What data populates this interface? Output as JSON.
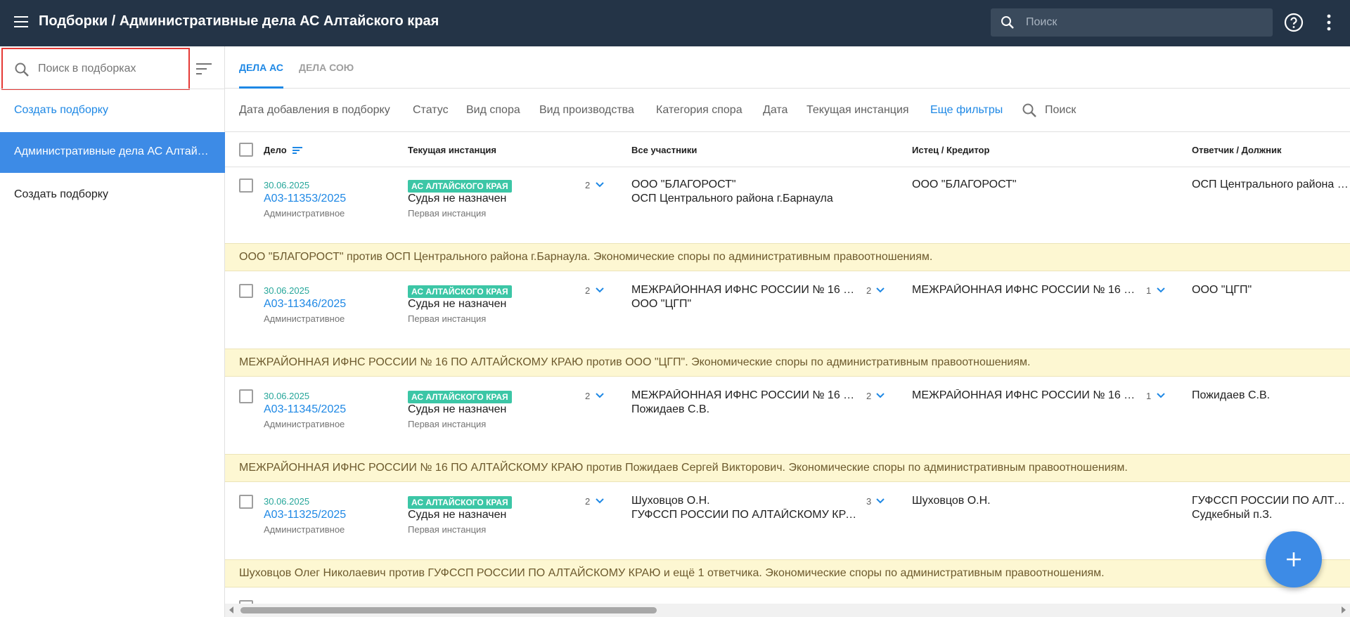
{
  "app": {
    "title": "Подборки / Административные дела АС Алтайского края",
    "search_placeholder": "Поиск"
  },
  "sidebar": {
    "search_placeholder": "Поиск в подборках",
    "create_link": "Создать подборку",
    "active_item": "Административные дела АС Алтайского края",
    "create_plain": "Создать подборку"
  },
  "tabs": [
    "ДЕЛА АС",
    "ДЕЛА СОЮ"
  ],
  "filters": [
    "Дата добавления в подборку",
    "Статус",
    "Вид спора",
    "Вид производства",
    "Категория спора",
    "Дата",
    "Текущая инстанция",
    "Еще фильтры"
  ],
  "filter_search": "Поиск",
  "columns": [
    "Дело",
    "Текущая инстанция",
    "Все участники",
    "Истец / Кредитор",
    "Ответчик / Должник"
  ],
  "rows": [
    {
      "date": "30.06.2025",
      "number": "А03-11353/2025",
      "type": "Административное",
      "badge": "АС АЛТАЙСКОГО КРАЯ",
      "judge": "Судья не назначен",
      "instance": "Первая инстанция",
      "instance_count": "2",
      "participants": [
        "ООО \"БЛАГОРОСТ\"",
        "ОСП Центрального района г.Барнаула"
      ],
      "participants_count": "",
      "plaintiff": "ООО \"БЛАГОРОСТ\"",
      "plaintiff_count": "",
      "defendant": [
        "ОСП Центрального района г.Барнаула"
      ],
      "summary": "ООО \"БЛАГОРОСТ\" против ОСП Центрального района г.Барнаула. Экономические споры по административным правоотношениям."
    },
    {
      "date": "30.06.2025",
      "number": "А03-11346/2025",
      "type": "Административное",
      "badge": "АС АЛТАЙСКОГО КРАЯ",
      "judge": "Судья не назначен",
      "instance": "Первая инстанция",
      "instance_count": "2",
      "participants": [
        "МЕЖРАЙОННАЯ ИФНС РОССИИ № 16 ПО АЛТАЙСКОМУ КРАЮ",
        "ООО \"ЦГП\""
      ],
      "participants_count": "2",
      "plaintiff": "МЕЖРАЙОННАЯ ИФНС РОССИИ № 16 ПО АЛТАЙСКОМУ КРАЮ",
      "plaintiff_count": "1",
      "defendant": [
        "ООО \"ЦГП\""
      ],
      "summary": "МЕЖРАЙОННАЯ ИФНС РОССИИ № 16 ПО АЛТАЙСКОМУ КРАЮ против ООО \"ЦГП\". Экономические споры по административным правоотношениям."
    },
    {
      "date": "30.06.2025",
      "number": "А03-11345/2025",
      "type": "Административное",
      "badge": "АС АЛТАЙСКОГО КРАЯ",
      "judge": "Судья не назначен",
      "instance": "Первая инстанция",
      "instance_count": "2",
      "participants": [
        "МЕЖРАЙОННАЯ ИФНС РОССИИ № 16 ПО АЛТАЙСКОМУ КРАЮ",
        "Пожидаев С.В."
      ],
      "participants_count": "2",
      "plaintiff": "МЕЖРАЙОННАЯ ИФНС РОССИИ № 16 ПО АЛТАЙСКОМУ КРАЮ",
      "plaintiff_count": "1",
      "defendant": [
        "Пожидаев С.В."
      ],
      "summary": "МЕЖРАЙОННАЯ ИФНС РОССИИ № 16 ПО АЛТАЙСКОМУ КРАЮ против Пожидаев Сергей Викторович. Экономические споры по административным правоотношениям."
    },
    {
      "date": "30.06.2025",
      "number": "А03-11325/2025",
      "type": "Административное",
      "badge": "АС АЛТАЙСКОГО КРАЯ",
      "judge": "Судья не назначен",
      "instance": "Первая инстанция",
      "instance_count": "2",
      "participants": [
        "Шуховцов О.Н.",
        "ГУФССП РОССИИ ПО АЛТАЙСКОМУ КРАЮ"
      ],
      "participants_count": "3",
      "plaintiff": "Шуховцов О.Н.",
      "plaintiff_count": "",
      "defendant": [
        "ГУФССП РОССИИ ПО АЛТАЙСКОМУ КРАЮ",
        "Судкебный п.З."
      ],
      "summary": "Шуховцов Олег Николаевич против ГУФССП РОССИИ ПО АЛТАЙСКОМУ КРАЮ и ещё 1 ответчика. Экономические споры по административным правоотношениям."
    }
  ],
  "colors": {
    "topbar": "#243447",
    "accent": "#1e88e5",
    "active_item": "#3d8be6",
    "badge": "#3cc6a6",
    "summary_bg": "#fdf7d2"
  }
}
